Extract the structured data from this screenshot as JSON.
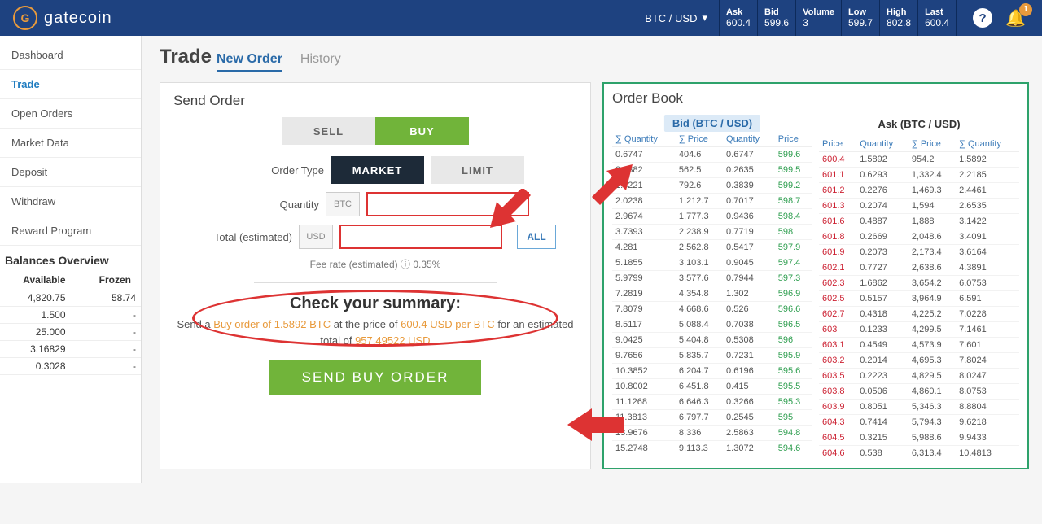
{
  "brand": "gatecoin",
  "pair": "BTC / USD",
  "stats": [
    {
      "label": "Ask",
      "val": "600.4"
    },
    {
      "label": "Bid",
      "val": "599.6"
    },
    {
      "label": "Volume",
      "val": "3"
    },
    {
      "label": "Low",
      "val": "599.7"
    },
    {
      "label": "High",
      "val": "802.8"
    },
    {
      "label": "Last",
      "val": "600.4"
    }
  ],
  "notif_count": "1",
  "sidebar": {
    "items": [
      "Dashboard",
      "Trade",
      "Open Orders",
      "Market Data",
      "Deposit",
      "Withdraw",
      "Reward Program"
    ],
    "active": 1
  },
  "balances": {
    "title": "Balances Overview",
    "head_avail": "Available",
    "head_frozen": "Frozen",
    "rows": [
      {
        "a": "4,820.75",
        "f": "58.74"
      },
      {
        "a": "1.500",
        "f": "-"
      },
      {
        "a": "25.000",
        "f": "-"
      },
      {
        "a": "3.16829",
        "f": "-"
      },
      {
        "a": "0.3028",
        "f": "-"
      }
    ]
  },
  "page_title": "Trade",
  "tabs": {
    "new": "New Order",
    "history": "History"
  },
  "send": {
    "title": "Send Order",
    "sell": "SELL",
    "buy": "BUY",
    "order_type": "Order Type",
    "market": "MARKET",
    "limit": "LIMIT",
    "quantity": "Quantity",
    "qty_unit": "BTC",
    "total": "Total (estimated)",
    "total_unit": "USD",
    "all": "ALL",
    "fee": "Fee rate (estimated) ⓘ 0.35%",
    "summary_title": "Check your summary:",
    "summary_p1": "Send a ",
    "summary_hl1": "Buy order of 1.5892 BTC",
    "summary_p2": " at the price of ",
    "summary_hl2": "600.4 USD per BTC",
    "summary_p3": " for an estimated total of ",
    "summary_hl3": "957.49522 USD",
    "send_btn": "SEND BUY ORDER"
  },
  "book": {
    "title": "Order Book",
    "bid_hd": "Bid (BTC / USD)",
    "ask_hd": "Ask (BTC / USD)",
    "cols_bid": [
      "∑ Quantity",
      "∑ Price",
      "Quantity",
      "Price"
    ],
    "cols_ask": [
      "Price",
      "Quantity",
      "∑ Price",
      "∑ Quantity"
    ],
    "bids": [
      [
        "0.6747",
        "404.6",
        "0.6747",
        "599.6"
      ],
      [
        "0.9382",
        "562.5",
        "0.2635",
        "599.5"
      ],
      [
        "1.3221",
        "792.6",
        "0.3839",
        "599.2"
      ],
      [
        "2.0238",
        "1,212.7",
        "0.7017",
        "598.7"
      ],
      [
        "2.9674",
        "1,777.3",
        "0.9436",
        "598.4"
      ],
      [
        "3.7393",
        "2,238.9",
        "0.7719",
        "598"
      ],
      [
        "4.281",
        "2,562.8",
        "0.5417",
        "597.9"
      ],
      [
        "5.1855",
        "3,103.1",
        "0.9045",
        "597.4"
      ],
      [
        "5.9799",
        "3,577.6",
        "0.7944",
        "597.3"
      ],
      [
        "7.2819",
        "4,354.8",
        "1.302",
        "596.9"
      ],
      [
        "7.8079",
        "4,668.6",
        "0.526",
        "596.6"
      ],
      [
        "8.5117",
        "5,088.4",
        "0.7038",
        "596.5"
      ],
      [
        "9.0425",
        "5,404.8",
        "0.5308",
        "596"
      ],
      [
        "9.7656",
        "5,835.7",
        "0.7231",
        "595.9"
      ],
      [
        "10.3852",
        "6,204.7",
        "0.6196",
        "595.6"
      ],
      [
        "10.8002",
        "6,451.8",
        "0.415",
        "595.5"
      ],
      [
        "11.1268",
        "6,646.3",
        "0.3266",
        "595.3"
      ],
      [
        "11.3813",
        "6,797.7",
        "0.2545",
        "595"
      ],
      [
        "13.9676",
        "8,336",
        "2.5863",
        "594.8"
      ],
      [
        "15.2748",
        "9,113.3",
        "1.3072",
        "594.6"
      ]
    ],
    "asks": [
      [
        "600.4",
        "1.5892",
        "954.2",
        "1.5892"
      ],
      [
        "601.1",
        "0.6293",
        "1,332.4",
        "2.2185"
      ],
      [
        "601.2",
        "0.2276",
        "1,469.3",
        "2.4461"
      ],
      [
        "601.3",
        "0.2074",
        "1,594",
        "2.6535"
      ],
      [
        "601.6",
        "0.4887",
        "1,888",
        "3.1422"
      ],
      [
        "601.8",
        "0.2669",
        "2,048.6",
        "3.4091"
      ],
      [
        "601.9",
        "0.2073",
        "2,173.4",
        "3.6164"
      ],
      [
        "602.1",
        "0.7727",
        "2,638.6",
        "4.3891"
      ],
      [
        "602.3",
        "1.6862",
        "3,654.2",
        "6.0753"
      ],
      [
        "602.5",
        "0.5157",
        "3,964.9",
        "6.591"
      ],
      [
        "602.7",
        "0.4318",
        "4,225.2",
        "7.0228"
      ],
      [
        "603",
        "0.1233",
        "4,299.5",
        "7.1461"
      ],
      [
        "603.1",
        "0.4549",
        "4,573.9",
        "7.601"
      ],
      [
        "603.2",
        "0.2014",
        "4,695.3",
        "7.8024"
      ],
      [
        "603.5",
        "0.2223",
        "4,829.5",
        "8.0247"
      ],
      [
        "603.8",
        "0.0506",
        "4,860.1",
        "8.0753"
      ],
      [
        "603.9",
        "0.8051",
        "5,346.3",
        "8.8804"
      ],
      [
        "604.3",
        "0.7414",
        "5,794.3",
        "9.6218"
      ],
      [
        "604.5",
        "0.3215",
        "5,988.6",
        "9.9433"
      ],
      [
        "604.6",
        "0.538",
        "6,313.4",
        "10.4813"
      ]
    ]
  }
}
